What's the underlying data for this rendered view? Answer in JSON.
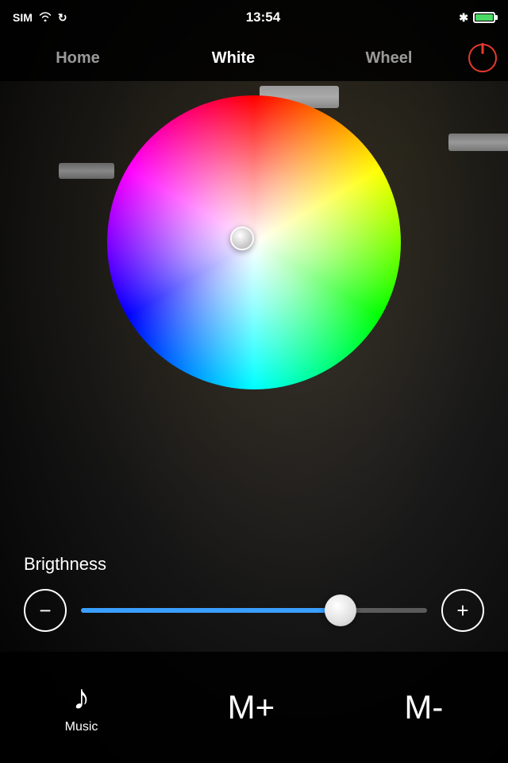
{
  "statusBar": {
    "carrier": "SIM",
    "wifi": "wifi",
    "refresh": "↻",
    "time": "13:54",
    "bluetooth": "✱",
    "battery_level": 90
  },
  "navBar": {
    "tabs": [
      {
        "id": "home",
        "label": "Home",
        "active": false
      },
      {
        "id": "white",
        "label": "White",
        "active": true
      },
      {
        "id": "wheel",
        "label": "Wheel",
        "active": false
      }
    ],
    "power_button_label": "power"
  },
  "colorWheel": {
    "picker_visible": true
  },
  "brightness": {
    "label": "Brigthness",
    "minus_label": "−",
    "plus_label": "+",
    "value": 75
  },
  "bottomBar": {
    "music_label": "Music",
    "music_icon": "♪",
    "mplus_label": "M+",
    "mminus_label": "M-"
  }
}
